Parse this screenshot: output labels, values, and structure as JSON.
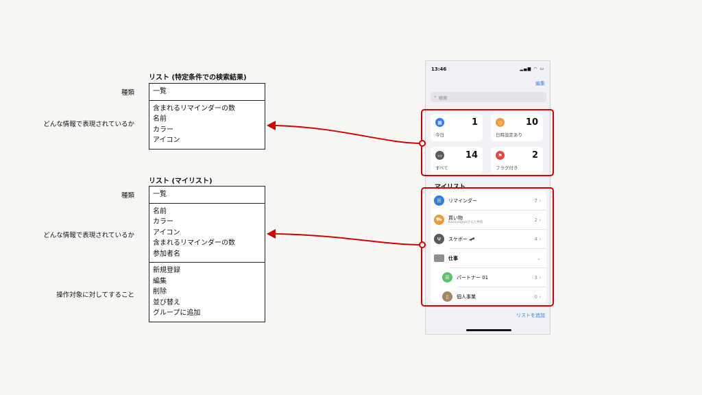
{
  "left": {
    "table1": {
      "title": "リスト (特定条件での検索結果)",
      "kind_label": "種類",
      "kind_value": "一覧",
      "info_label": "どんな情報で表現されているか",
      "info_lines": [
        "含まれるリマインダーの数",
        "名前",
        "カラー",
        "アイコン"
      ]
    },
    "table2": {
      "title": "リスト (マイリスト)",
      "kind_label": "種類",
      "kind_value": "一覧",
      "info_label": "どんな情報で表現されているか",
      "info_lines": [
        "名前",
        "カラー",
        "アイコン",
        "含まれるリマインダーの数",
        "参加者名"
      ],
      "ops_label": "操作対象に対してすること",
      "ops_lines": [
        "新規登録",
        "編集",
        "削除",
        "並び替え",
        "グループに追加"
      ]
    }
  },
  "phone": {
    "time": "13:46",
    "status_icons": "▂▄▆ ◠ ▭",
    "edit": "編集",
    "search_placeholder": "検索",
    "search_icon": "search-icon",
    "cards": [
      {
        "label": "今日",
        "count": "1",
        "color": "#2f7cf6",
        "icon": "calendar-icon"
      },
      {
        "label": "日時設定あり",
        "count": "10",
        "color": "#f09a36",
        "icon": "clock-icon"
      },
      {
        "label": "すべて",
        "count": "14",
        "color": "#5a5a5e",
        "icon": "tray-icon"
      },
      {
        "label": "フラグ付き",
        "count": "2",
        "color": "#e8453c",
        "icon": "flag-icon"
      }
    ],
    "mylist_title": "マイリスト",
    "lists": [
      {
        "name": "リマインダー",
        "count": "7",
        "color": "#2f7cf6",
        "icon": "list-icon"
      },
      {
        "name": "買い物",
        "sub": "Kaminogoyaさんと共有",
        "count": "2",
        "color": "#f09a36",
        "icon": "cart-icon"
      },
      {
        "name": "スケボー 🛹",
        "count": "4",
        "color": "#5a5a5e",
        "icon": "utensils-icon"
      },
      {
        "name": "仕事",
        "color": "#8e8e93",
        "icon": "folder-icon"
      },
      {
        "name": "パートナー 01",
        "count": "3",
        "color": "#5ac36b",
        "icon": "list-icon"
      },
      {
        "name": "個人事業",
        "count": "0",
        "color": "#a28764",
        "icon": "device-icon"
      }
    ],
    "add_list": "リストを追加"
  },
  "colors": {
    "accent": "#2f7cf6",
    "highlight": "#d60000"
  }
}
